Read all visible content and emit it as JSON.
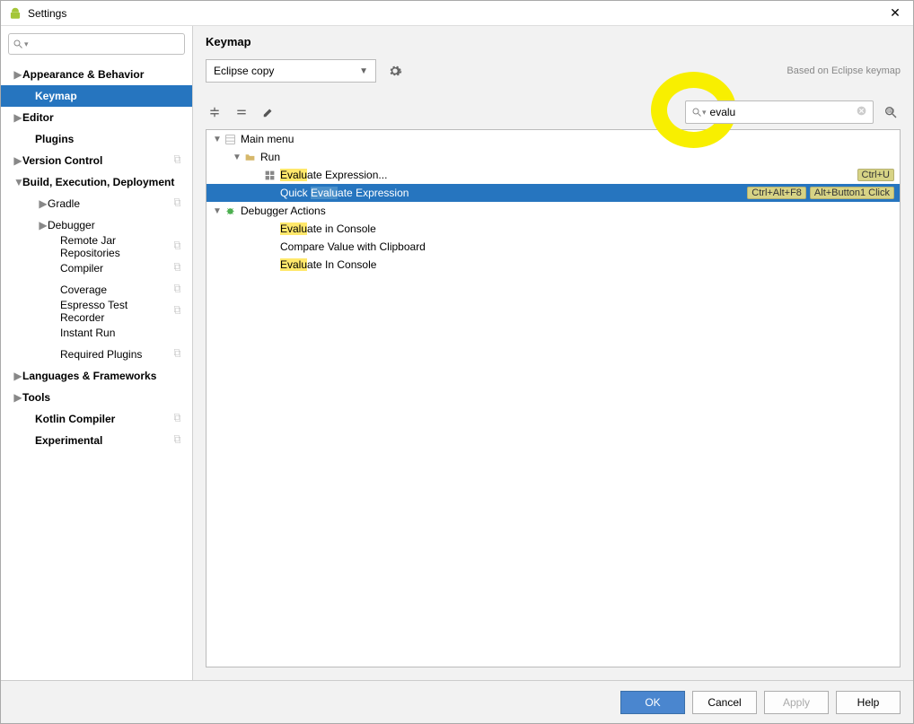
{
  "window": {
    "title": "Settings"
  },
  "sidebar": {
    "search_placeholder": "",
    "items": [
      {
        "label": "Appearance & Behavior",
        "indent": 1,
        "arrow": "▶",
        "bold": true
      },
      {
        "label": "Keymap",
        "indent": 2,
        "bold": true,
        "selected": true
      },
      {
        "label": "Editor",
        "indent": 1,
        "arrow": "▶",
        "bold": true
      },
      {
        "label": "Plugins",
        "indent": 2,
        "bold": true
      },
      {
        "label": "Version Control",
        "indent": 1,
        "arrow": "▶",
        "bold": true,
        "copy": true
      },
      {
        "label": "Build, Execution, Deployment",
        "indent": 1,
        "arrow": "▼",
        "bold": true
      },
      {
        "label": "Gradle",
        "indent": 3,
        "arrow": "▶",
        "copy": true
      },
      {
        "label": "Debugger",
        "indent": 3,
        "arrow": "▶"
      },
      {
        "label": "Remote Jar Repositories",
        "indent": 4,
        "copy": true
      },
      {
        "label": "Compiler",
        "indent": 4,
        "copy": true
      },
      {
        "label": "Coverage",
        "indent": 4,
        "copy": true
      },
      {
        "label": "Espresso Test Recorder",
        "indent": 4,
        "copy": true
      },
      {
        "label": "Instant Run",
        "indent": 4
      },
      {
        "label": "Required Plugins",
        "indent": 4,
        "copy": true
      },
      {
        "label": "Languages & Frameworks",
        "indent": 1,
        "arrow": "▶",
        "bold": true
      },
      {
        "label": "Tools",
        "indent": 1,
        "arrow": "▶",
        "bold": true
      },
      {
        "label": "Kotlin Compiler",
        "indent": 2,
        "bold": true,
        "copy": true
      },
      {
        "label": "Experimental",
        "indent": 2,
        "bold": true,
        "copy": true
      }
    ]
  },
  "main": {
    "heading": "Keymap",
    "scheme": "Eclipse copy",
    "based_on": "Based on Eclipse keymap",
    "search_value": "evalu",
    "actions": [
      {
        "indent": 0,
        "arrow": "▼",
        "icon": "menu",
        "label": "Main menu"
      },
      {
        "indent": 1,
        "arrow": "▼",
        "icon": "folder",
        "label": "Run"
      },
      {
        "indent": 2,
        "icon": "grid",
        "label_pre": "",
        "hl": "Evalu",
        "label_post": "ate Expression...",
        "shortcuts": [
          "Ctrl+U"
        ]
      },
      {
        "indent": 2,
        "label_pre": "Quick ",
        "hl": "Evalu",
        "label_post": "ate Expression",
        "shortcuts": [
          "Ctrl+Alt+F8",
          "Alt+Button1 Click"
        ],
        "selected": true
      },
      {
        "indent": 0,
        "arrow": "▼",
        "icon": "bug",
        "label": "Debugger Actions"
      },
      {
        "indent": 2,
        "label_pre": "",
        "hl": "Evalu",
        "label_post": "ate in Console"
      },
      {
        "indent": 2,
        "label": "Compare Value with Clipboard"
      },
      {
        "indent": 2,
        "label_pre": "",
        "hl": "Evalu",
        "label_post": "ate In Console"
      }
    ]
  },
  "footer": {
    "ok": "OK",
    "cancel": "Cancel",
    "apply": "Apply",
    "help": "Help"
  }
}
